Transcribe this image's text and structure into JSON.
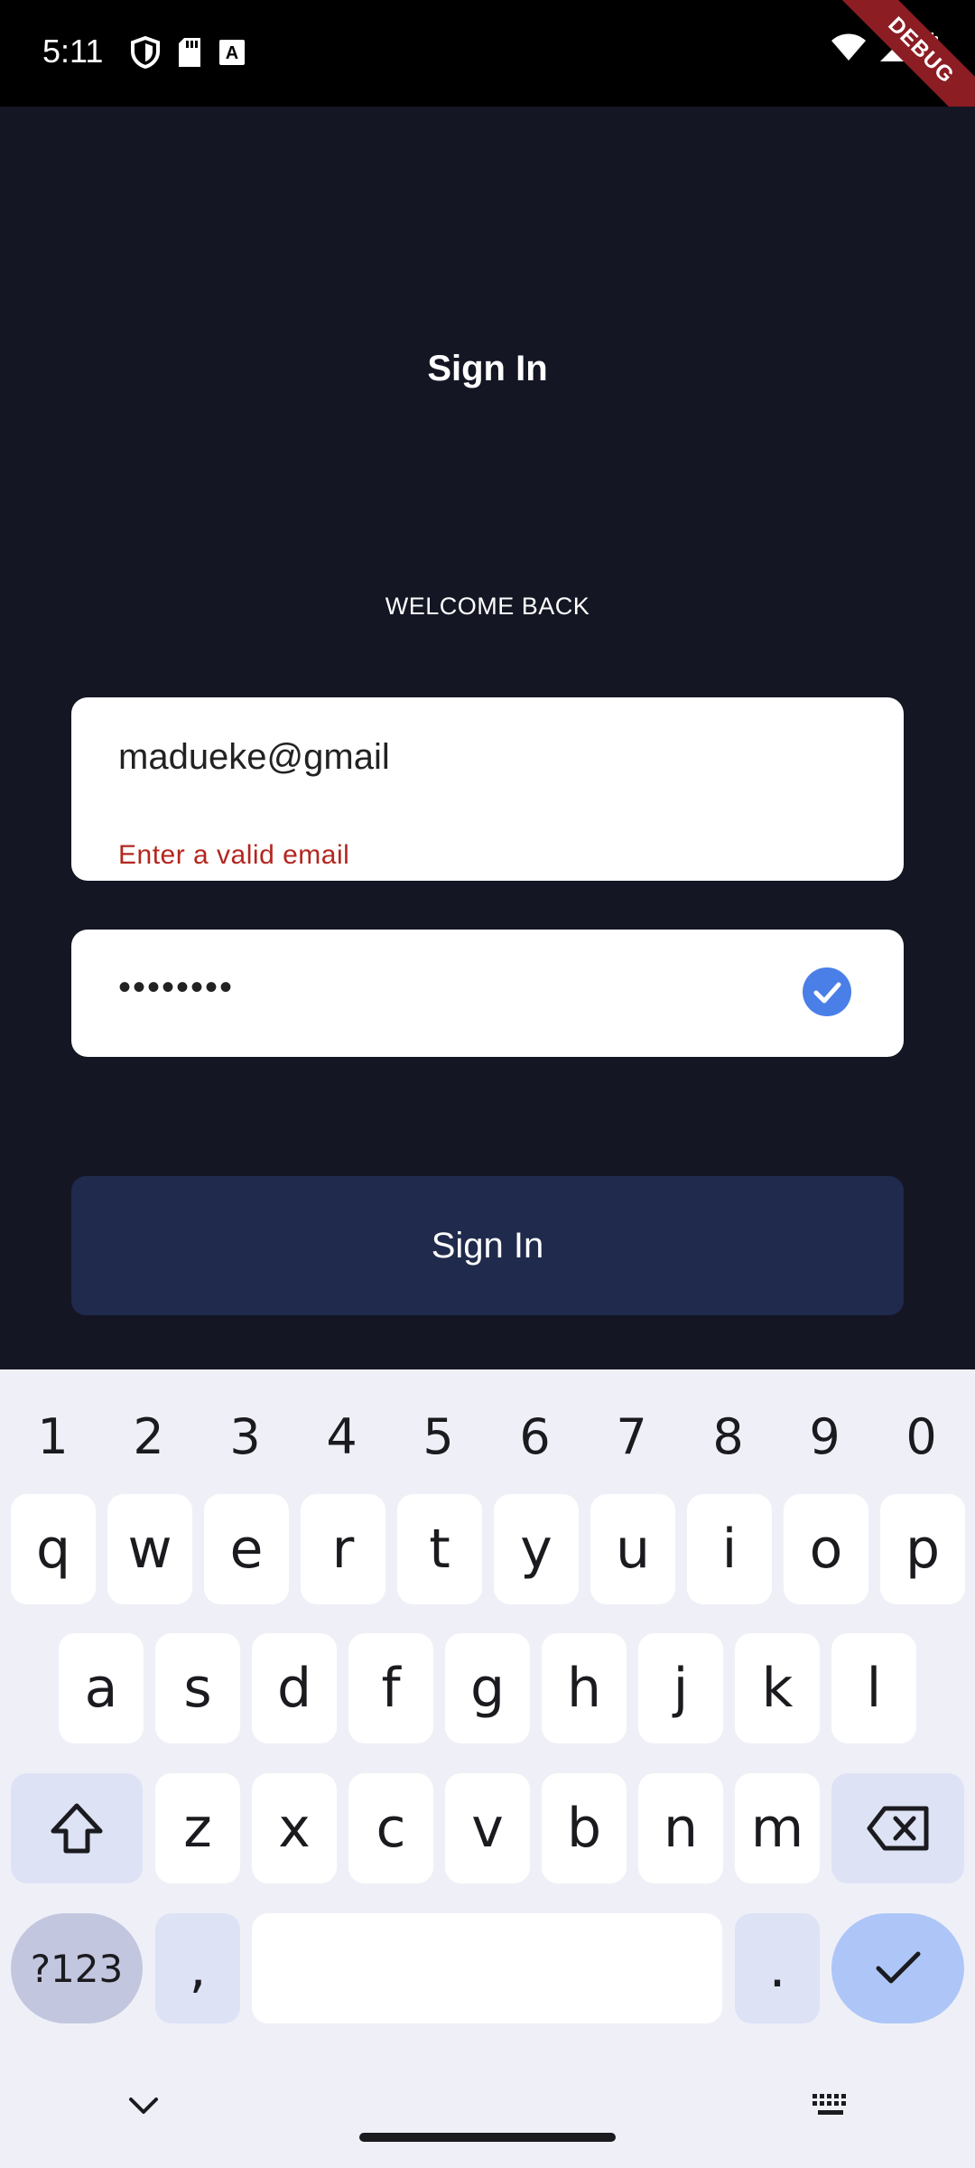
{
  "status_bar": {
    "time": "5:11",
    "left_icons": [
      "shield-icon",
      "sd-card-icon",
      "keyboard-a-icon"
    ],
    "right_icons": [
      "wifi-icon",
      "signal-icon",
      "battery-icon"
    ],
    "debug_banner": "DEBUG"
  },
  "page": {
    "title": "Sign In",
    "welcome_text": "WELCOME BACK"
  },
  "form": {
    "email": {
      "value": "madueke@gmail",
      "error": "Enter a valid email"
    },
    "password": {
      "value": "••••••••",
      "status_icon": "check-circle-icon"
    },
    "submit_label": "Sign In"
  },
  "colors": {
    "background": "#141624",
    "button": "#1f2a4c",
    "error": "#b3261e",
    "check": "#4a7fe8"
  },
  "keyboard": {
    "number_row": [
      "1",
      "2",
      "3",
      "4",
      "5",
      "6",
      "7",
      "8",
      "9",
      "0"
    ],
    "row1": [
      "q",
      "w",
      "e",
      "r",
      "t",
      "y",
      "u",
      "i",
      "o",
      "p"
    ],
    "row2": [
      "a",
      "s",
      "d",
      "f",
      "g",
      "h",
      "j",
      "k",
      "l"
    ],
    "row3": [
      "z",
      "x",
      "c",
      "v",
      "b",
      "n",
      "m"
    ],
    "symbols_label": "?123",
    "comma": ",",
    "period": ".",
    "shift_icon": "shift-icon",
    "backspace_icon": "backspace-icon",
    "enter_icon": "check-icon",
    "hide_icon": "chevron-down-icon",
    "switch_icon": "keyboard-icon"
  }
}
